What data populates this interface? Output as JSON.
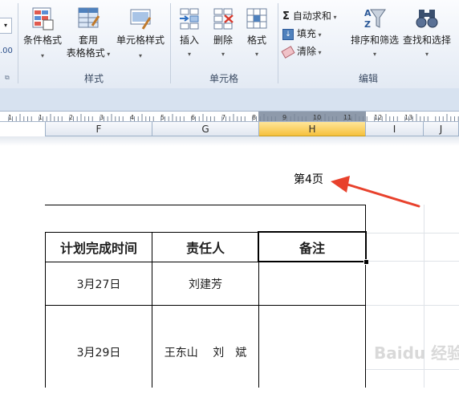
{
  "ribbon": {
    "styles_group": {
      "label": "样式",
      "conditional_format": "条件格式",
      "table_format_line1": "套用",
      "table_format_line2": "表格格式",
      "cell_styles": "单元格样式"
    },
    "cells_group": {
      "label": "单元格",
      "insert": "插入",
      "delete": "删除",
      "format": "格式"
    },
    "editing_group": {
      "label": "编辑",
      "autosum": "自动求和",
      "fill": "填充",
      "clear": "清除",
      "sort_filter": "排序和筛选",
      "find_select": "查找和选择"
    }
  },
  "ruler": {
    "ticks": [
      "1",
      "1",
      "2",
      "3",
      "4",
      "5",
      "6",
      "7",
      "8",
      "9",
      "10",
      "11",
      "12",
      "13"
    ]
  },
  "columns": [
    "F",
    "G",
    "H",
    "I",
    "J"
  ],
  "selected_column": "H",
  "page_label": "第4页",
  "table": {
    "headers": [
      "计划完成时间",
      "责任人",
      "备注"
    ],
    "rows": [
      [
        "3月27日",
        "刘建芳",
        ""
      ],
      [
        "3月29日",
        "王东山　 刘　斌",
        ""
      ]
    ]
  },
  "annotation": {
    "arrow_color": "#e8412c"
  },
  "watermark": "Baidu 经验",
  "colors": {
    "accent_selected_col": "#f6c13c",
    "ribbon_bg": "#e3eaf4"
  }
}
